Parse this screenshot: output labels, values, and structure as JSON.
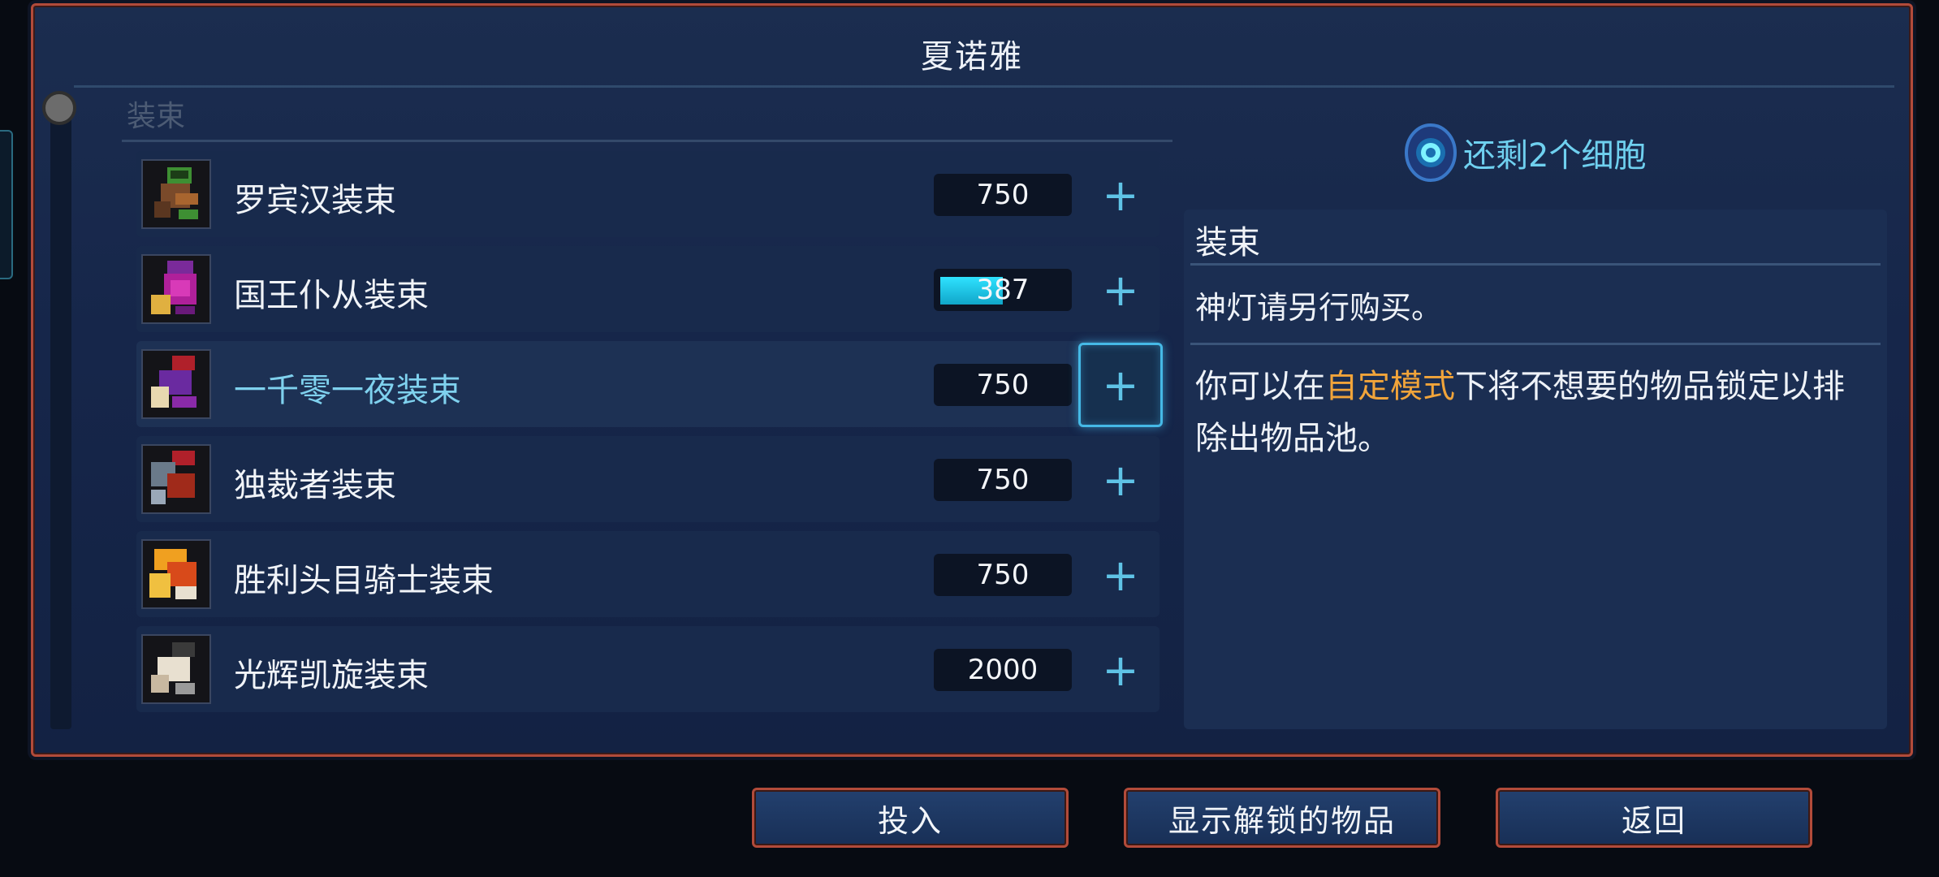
{
  "title": "夏诺雅",
  "section_header": "装束",
  "items": [
    {
      "name": "罗宾汉装束",
      "cost": "750",
      "progress": 0,
      "icon": "robin-hood-outfit-icon",
      "selected": false
    },
    {
      "name": "国王仆从装束",
      "cost": "387",
      "progress": 0.5,
      "icon": "kings-servant-outfit-icon",
      "selected": false
    },
    {
      "name": "一千零一夜装束",
      "cost": "750",
      "progress": 0,
      "icon": "arabian-nights-outfit-icon",
      "selected": true
    },
    {
      "name": "独裁者装束",
      "cost": "750",
      "progress": 0,
      "icon": "dictator-outfit-icon",
      "selected": false
    },
    {
      "name": "胜利头目骑士装束",
      "cost": "750",
      "progress": 0,
      "icon": "victorious-boss-knight-outfit-icon",
      "selected": false
    },
    {
      "name": "光辉凯旋装束",
      "cost": "2000",
      "progress": 0,
      "icon": "glorious-triumph-outfit-icon",
      "selected": false
    }
  ],
  "cells_remaining": "还剩2个细胞",
  "description": {
    "title": "装束",
    "line1": "神灯请另行购买。",
    "line2_before": "你可以在",
    "line2_highlight": "自定模式",
    "line2_after": "下将不想要的物品锁定以排除出物品池。"
  },
  "buttons": {
    "invest": "投入",
    "show_unlocked": "显示解锁的物品",
    "back": "返回"
  },
  "colors": {
    "accent": "#45b9e6",
    "highlight": "#f1a43a",
    "border": "#b24b3a",
    "progress": "#2fe2ff"
  }
}
